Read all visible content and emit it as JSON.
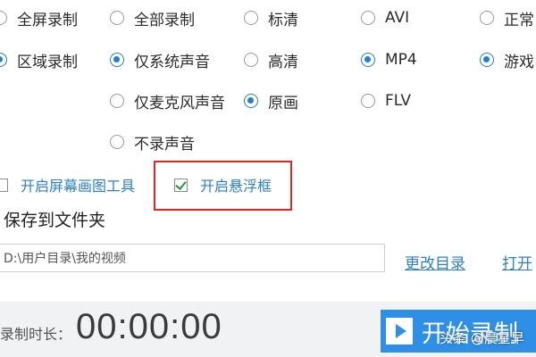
{
  "record_area": {
    "full_screen": "全屏录制",
    "region": "区域录制"
  },
  "audio": {
    "all": "全部录制",
    "system_only": "仅系统声音",
    "mic_only": "仅麦克风声音",
    "none": "不录声音"
  },
  "quality": {
    "standard": "标清",
    "high": "高清",
    "original": "原画"
  },
  "format": {
    "avi": "AVI",
    "mp4": "MP4",
    "flv": "FLV"
  },
  "mode": {
    "normal": "正常",
    "game": "游戏"
  },
  "tools": {
    "draw_tool": "开启屏幕画图工具",
    "float_window": "开启悬浮框"
  },
  "save": {
    "title": "保存到文件夹",
    "path": "D:\\用户目录\\我的视频",
    "change_dir": "更改目录",
    "open": "打开"
  },
  "footer": {
    "duration_label": "录制时长：",
    "duration_value": "00:00:00",
    "start_button": "开始录制",
    "watermark": "头条 @晨星早"
  },
  "colors": {
    "accent": "#1f7fd8",
    "link": "#2a7fd0",
    "highlight_border": "#e12626",
    "button": "#2f8fe6"
  }
}
